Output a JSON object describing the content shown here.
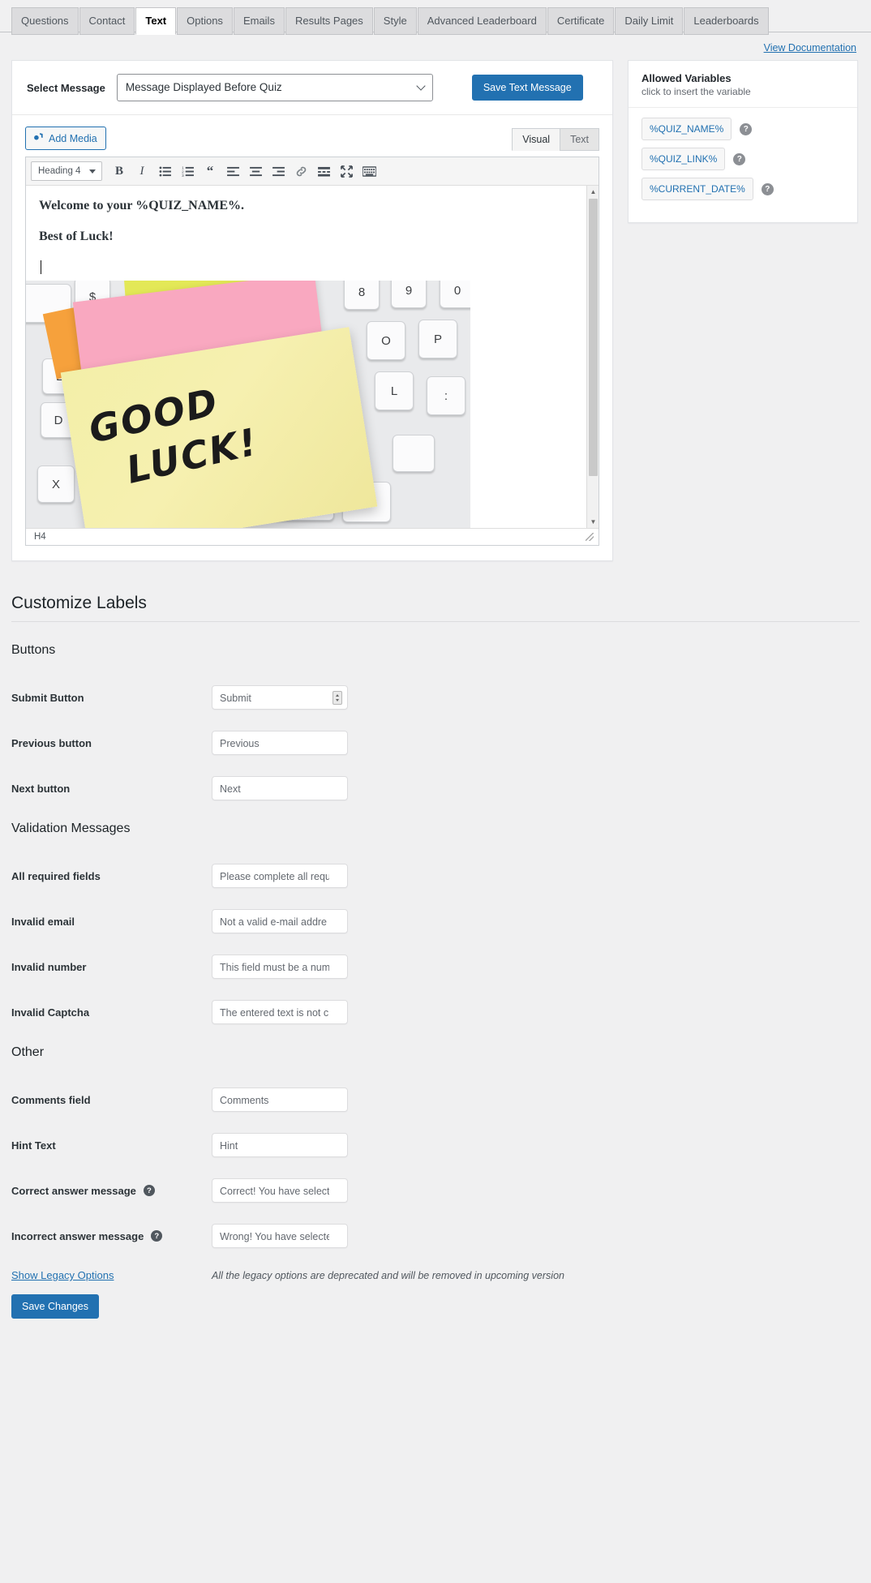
{
  "tabs": [
    {
      "label": "Questions",
      "active": false
    },
    {
      "label": "Contact",
      "active": false
    },
    {
      "label": "Text",
      "active": true
    },
    {
      "label": "Options",
      "active": false
    },
    {
      "label": "Emails",
      "active": false
    },
    {
      "label": "Results Pages",
      "active": false
    },
    {
      "label": "Style",
      "active": false
    },
    {
      "label": "Advanced Leaderboard",
      "active": false
    },
    {
      "label": "Certificate",
      "active": false
    },
    {
      "label": "Daily Limit",
      "active": false
    },
    {
      "label": "Leaderboards",
      "active": false
    }
  ],
  "doc_link": "View Documentation",
  "message_panel": {
    "select_label": "Select Message",
    "selected_message": "Message Displayed Before Quiz",
    "save_button": "Save Text Message"
  },
  "editor": {
    "add_media": "Add Media",
    "tab_visual": "Visual",
    "tab_text": "Text",
    "format_select": "Heading 4",
    "toolbar_icons": [
      "bold-icon",
      "italic-icon",
      "bulleted-list-icon",
      "numbered-list-icon",
      "blockquote-icon",
      "align-left-icon",
      "align-center-icon",
      "align-right-icon",
      "insert-link-icon",
      "read-more-icon",
      "fullscreen-icon",
      "toolbar-toggle-icon"
    ],
    "line1": "Welcome to your %QUIZ_NAME%.",
    "line2": "Best of Luck!",
    "image_text_line1": "GOOD",
    "image_text_line2": "LUCK!",
    "status_path": "H4"
  },
  "allowed_variables": {
    "title": "Allowed Variables",
    "subtitle": "click to insert the variable",
    "items": [
      {
        "name": "%QUIZ_NAME%"
      },
      {
        "name": "%QUIZ_LINK%"
      },
      {
        "name": "%CURRENT_DATE%"
      }
    ],
    "help_glyph": "?"
  },
  "customize": {
    "title": "Customize Labels",
    "sections": [
      {
        "title": "Buttons",
        "fields": [
          {
            "label": "Submit Button",
            "value": "Submit",
            "help": false,
            "spinner": true
          },
          {
            "label": "Previous button",
            "value": "Previous",
            "help": false,
            "spinner": false
          },
          {
            "label": "Next button",
            "value": "Next",
            "help": false,
            "spinner": false
          }
        ]
      },
      {
        "title": "Validation Messages",
        "fields": [
          {
            "label": "All required fields",
            "value": "Please complete all requ",
            "help": false,
            "spinner": false
          },
          {
            "label": "Invalid email",
            "value": "Not a valid e-mail addre",
            "help": false,
            "spinner": false
          },
          {
            "label": "Invalid number",
            "value": "This field must be a num",
            "help": false,
            "spinner": false
          },
          {
            "label": "Invalid Captcha",
            "value": "The entered text is not c",
            "help": false,
            "spinner": false
          }
        ]
      },
      {
        "title": "Other",
        "fields": [
          {
            "label": "Comments field",
            "value": "Comments",
            "help": false,
            "spinner": false
          },
          {
            "label": "Hint Text",
            "value": "Hint",
            "help": false,
            "spinner": false
          },
          {
            "label": "Correct answer message",
            "value": "Correct! You have selecte",
            "help": true,
            "spinner": false
          },
          {
            "label": "Incorrect answer message",
            "value": "Wrong! You have selecte",
            "help": true,
            "spinner": false
          }
        ]
      }
    ]
  },
  "footer": {
    "legacy_link": "Show Legacy Options",
    "legacy_note": "All the legacy options are deprecated and will be removed in upcoming version",
    "save_button": "Save Changes"
  },
  "colors": {
    "accent": "#2271b1",
    "page_bg": "#f0f0f1",
    "panel_bg": "#ffffff"
  }
}
